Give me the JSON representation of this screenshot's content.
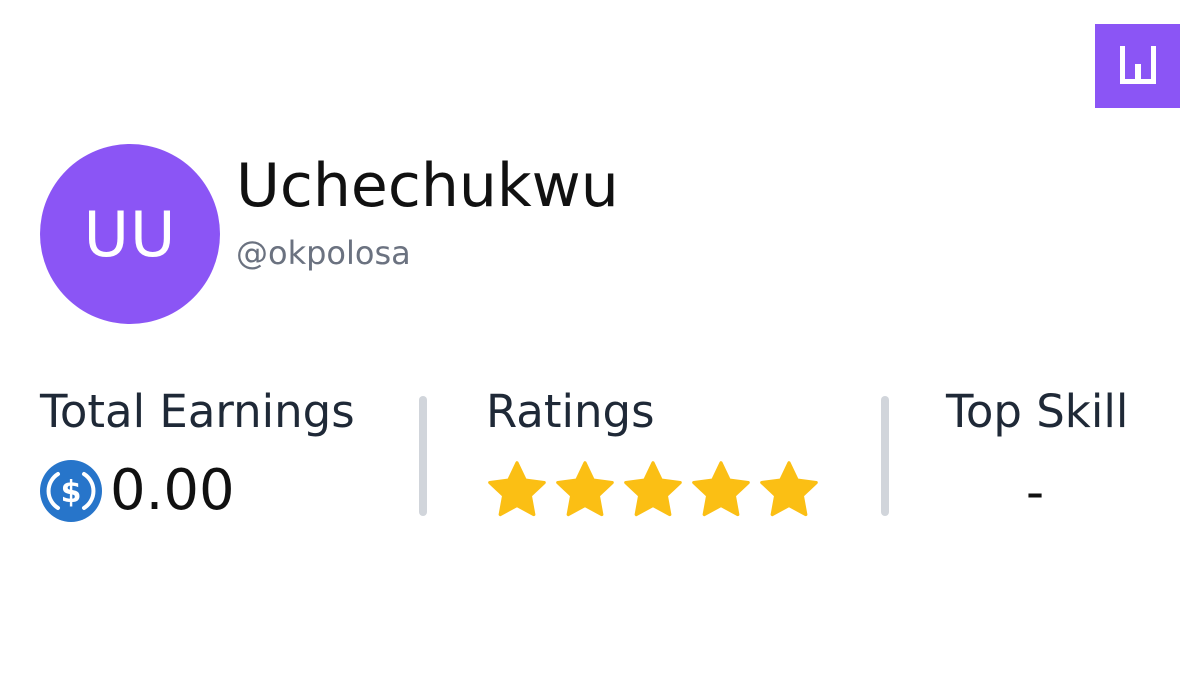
{
  "brand": {
    "logo_icon": "w-logo-icon",
    "color": "#8b55f5"
  },
  "profile": {
    "initials": "UU",
    "name": "Uchechukwu",
    "handle": "@okpolosa",
    "avatar_color": "#8b55f5"
  },
  "stats": {
    "total_earnings": {
      "label": "Total Earnings",
      "icon": "usdc-coin-icon",
      "value": "0.00"
    },
    "ratings": {
      "label": "Ratings",
      "icon": "star-icon",
      "stars": 5,
      "max": 5,
      "star_color": "#fbbf14"
    },
    "top_skill": {
      "label": "Top Skill",
      "value": "-"
    }
  }
}
